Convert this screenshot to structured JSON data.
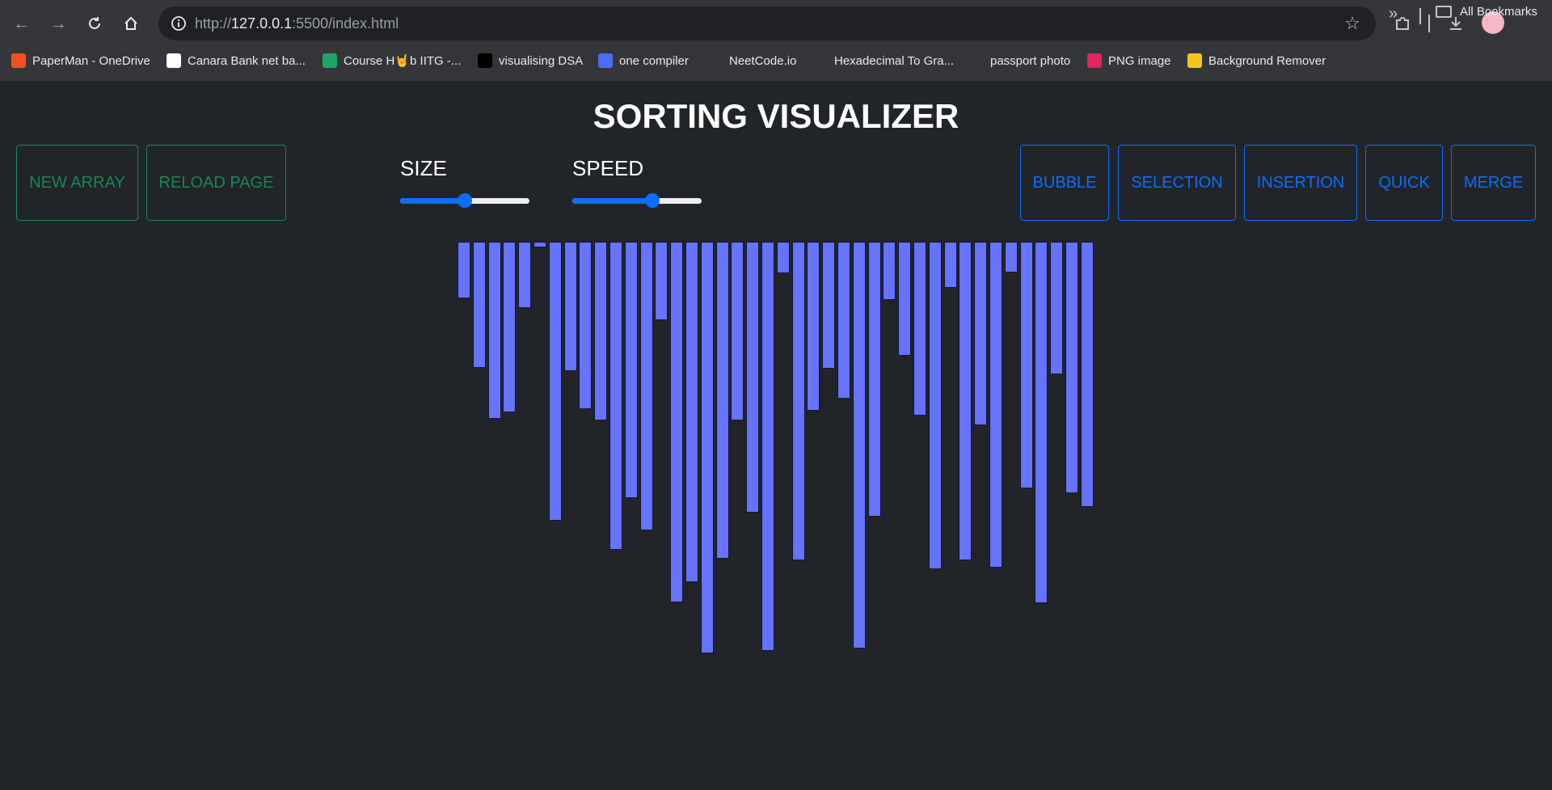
{
  "browser": {
    "url_scheme": "http://",
    "url_host": "127.0.0.1",
    "url_path": ":5500/index.html",
    "bookmarks": [
      {
        "label": "PaperMan - OneDrive",
        "icon": "microsoft-icon",
        "color": "#f25022"
      },
      {
        "label": "Canara Bank net ba...",
        "icon": "canara-bank-icon",
        "color": "#ffffff"
      },
      {
        "label": "Course H🤘b IITG -...",
        "icon": "google-drive-icon",
        "color": "#1fa463"
      },
      {
        "label": "visualising DSA",
        "icon": "visualgo-icon",
        "color": "#000000"
      },
      {
        "label": "one compiler",
        "icon": "code-icon",
        "color": "#4b6cf7"
      },
      {
        "label": "NeetCode.io",
        "icon": "rocket-icon",
        "color": "#35363a"
      },
      {
        "label": "Hexadecimal To Gra...",
        "icon": "atom-icon",
        "color": "#35363a"
      },
      {
        "label": "passport photo",
        "icon": "c-logo-icon",
        "color": "#35363a"
      },
      {
        "label": "PNG image",
        "icon": "png-icon",
        "color": "#e0245e"
      },
      {
        "label": "Background Remover",
        "icon": "layers-icon",
        "color": "#f5c518"
      }
    ],
    "all_bookmarks_label": "All Bookmarks"
  },
  "page": {
    "title": "SORTING VISUALIZER",
    "left_buttons": [
      {
        "label": "NEW ARRAY"
      },
      {
        "label": "RELOAD PAGE"
      }
    ],
    "size_label": "SIZE",
    "size_value": 0.5,
    "speed_label": "SPEED",
    "speed_value": 0.62,
    "algorithm_buttons": [
      {
        "label": "BUBBLE"
      },
      {
        "label": "SELECTION"
      },
      {
        "label": "INSERTION"
      },
      {
        "label": "QUICK"
      },
      {
        "label": "MERGE"
      }
    ],
    "colors": {
      "background": "#212529",
      "bar": "#6673ff",
      "green": "#198754",
      "blue": "#0d6efd"
    },
    "array": [
      70,
      156,
      219,
      211,
      82,
      7,
      345,
      160,
      207,
      221,
      381,
      317,
      357,
      97,
      446,
      421,
      509,
      392,
      221,
      335,
      506,
      39,
      394,
      209,
      157,
      194,
      503,
      340,
      72,
      141,
      215,
      405,
      57,
      394,
      227,
      403,
      38,
      305,
      447,
      164,
      311,
      328
    ]
  }
}
